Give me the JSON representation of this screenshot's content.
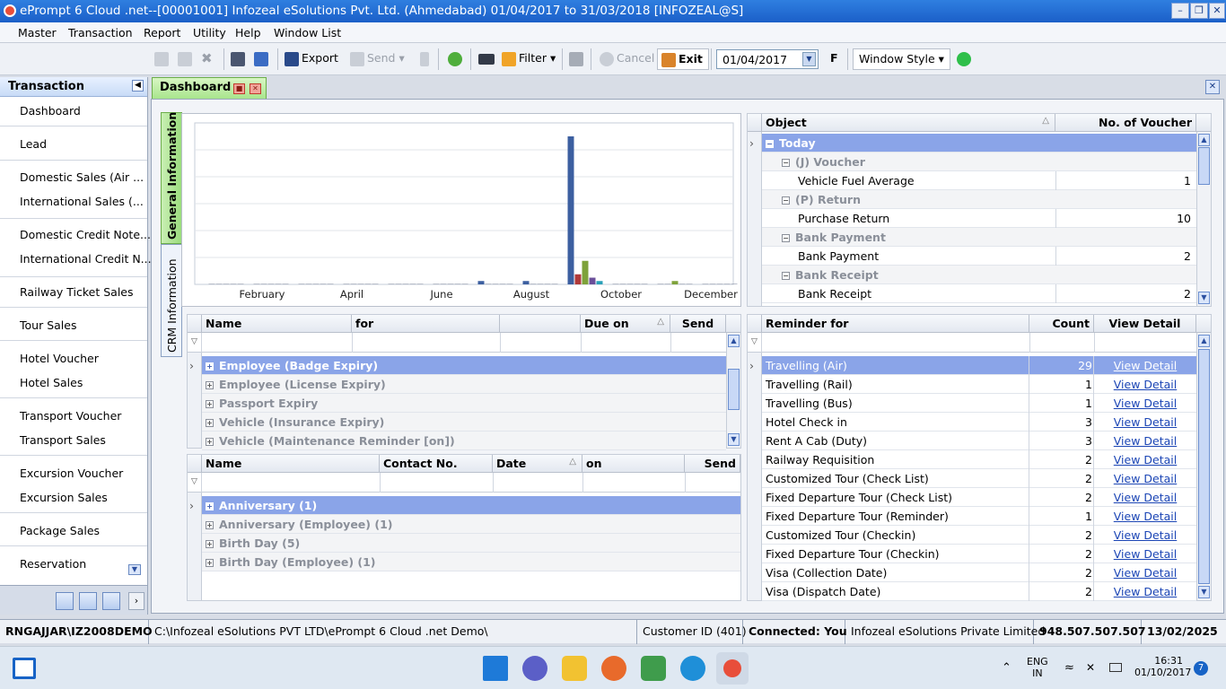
{
  "window": {
    "title": "ePrompt 6 Cloud .net--[00001001] Infozeal eSolutions Pvt. Ltd. (Ahmedabad) 01/04/2017 to 31/03/2018 [INFOZEAL@S]"
  },
  "menu": [
    "Master",
    "Transaction",
    "Report",
    "Utility",
    "Help",
    "Window List"
  ],
  "toolbar": {
    "export": "Export",
    "send": "Send",
    "filter": "Filter",
    "cancel": "Cancel",
    "exit": "Exit",
    "date": "01/04/2017",
    "f_label": "F",
    "window_style": "Window Style"
  },
  "sidebar": {
    "title": "Transaction",
    "items": [
      "Dashboard",
      "Lead",
      "Domestic Sales (Air ...",
      "International Sales (...",
      "Domestic Credit Note...",
      "International Credit N...",
      "Railway Ticket Sales",
      "Tour Sales",
      "Hotel Voucher",
      "Hotel Sales",
      "Transport Voucher",
      "Transport Sales",
      "Excursion Voucher",
      "Excursion Sales",
      "Package Sales",
      "Reservation"
    ]
  },
  "tabs": {
    "dashboard": "Dashboard",
    "vertical": [
      "General Information",
      "CRM Information"
    ]
  },
  "chart_data": {
    "type": "bar",
    "tick_labels": [
      "February",
      "April",
      "June",
      "August",
      "October",
      "December"
    ],
    "series": [
      {
        "color": "#3c5fa0",
        "values": [
          0,
          0,
          0,
          0,
          0,
          0,
          1,
          1,
          44,
          0,
          0,
          0
        ]
      },
      {
        "color": "#b03a3a",
        "values": [
          0,
          0,
          0,
          0,
          0,
          0,
          0,
          0,
          3,
          0,
          0,
          0
        ]
      },
      {
        "color": "#7ea23a",
        "values": [
          0,
          0,
          0,
          0,
          0,
          0,
          0,
          0,
          7,
          0,
          1,
          0
        ]
      },
      {
        "color": "#6b4f9a",
        "values": [
          0,
          0,
          0,
          0,
          0,
          0,
          0,
          0,
          2,
          0,
          0,
          0
        ]
      },
      {
        "color": "#2aa0b8",
        "values": [
          0,
          0,
          0,
          0,
          0,
          0,
          0,
          0,
          1,
          0,
          0,
          0
        ]
      }
    ],
    "ylim": [
      0,
      48
    ],
    "grid": true
  },
  "object_grid": {
    "headers": [
      "Object",
      "No. of Voucher"
    ],
    "rows": [
      {
        "kind": "sel",
        "label": "Today",
        "value": ""
      },
      {
        "kind": "grp",
        "label": "(J) Voucher",
        "value": ""
      },
      {
        "kind": "data",
        "label": "Vehicle Fuel Average",
        "value": "1"
      },
      {
        "kind": "grp",
        "label": "(P) Return",
        "value": ""
      },
      {
        "kind": "data",
        "label": "Purchase Return",
        "value": "10"
      },
      {
        "kind": "grp",
        "label": "Bank Payment",
        "value": ""
      },
      {
        "kind": "data",
        "label": "Bank Payment",
        "value": "2"
      },
      {
        "kind": "grp",
        "label": "Bank Receipt",
        "value": ""
      },
      {
        "kind": "data",
        "label": "Bank Receipt",
        "value": "2"
      }
    ]
  },
  "expiry_grid": {
    "headers": [
      "Name",
      "for",
      "",
      "Due on",
      "Send"
    ],
    "rows": [
      {
        "kind": "sel",
        "label": "Employee (Badge Expiry)"
      },
      {
        "kind": "grp",
        "label": "Employee (License Expiry)"
      },
      {
        "kind": "grp",
        "label": "Passport Expiry"
      },
      {
        "kind": "grp",
        "label": "Vehicle (Insurance Expiry)"
      },
      {
        "kind": "grp",
        "label": "Vehicle (Maintenance Reminder [on])"
      }
    ]
  },
  "event_grid": {
    "headers": [
      "Name",
      "Contact No.",
      "Date",
      "on",
      "Send"
    ],
    "rows": [
      {
        "kind": "sel",
        "label": "Anniversary (1)"
      },
      {
        "kind": "grp",
        "label": "Anniversary (Employee) (1)"
      },
      {
        "kind": "grp",
        "label": "Birth Day (5)"
      },
      {
        "kind": "grp",
        "label": "Birth Day (Employee) (1)"
      }
    ]
  },
  "reminder_grid": {
    "headers": [
      "Reminder for",
      "Count",
      "View Detail"
    ],
    "link_text": "View Detail",
    "rows": [
      {
        "label": "Travelling (Air)",
        "count": "29"
      },
      {
        "label": "Travelling (Rail)",
        "count": "1"
      },
      {
        "label": "Travelling (Bus)",
        "count": "1"
      },
      {
        "label": "Hotel Check in",
        "count": "3"
      },
      {
        "label": "Rent A Cab (Duty)",
        "count": "3"
      },
      {
        "label": "Railway Requisition",
        "count": "2"
      },
      {
        "label": "Customized Tour (Check List)",
        "count": "2"
      },
      {
        "label": "Fixed Departure Tour (Check List)",
        "count": "2"
      },
      {
        "label": "Fixed Departure Tour (Reminder)",
        "count": "1"
      },
      {
        "label": "Customized Tour (Checkin)",
        "count": "2"
      },
      {
        "label": "Fixed Departure Tour (Checkin)",
        "count": "2"
      },
      {
        "label": "Visa (Collection Date)",
        "count": "2"
      },
      {
        "label": "Visa (Dispatch Date)",
        "count": "2"
      }
    ]
  },
  "statusbar": {
    "user": "RNGAJJAR\\IZ2008DEMO",
    "path": "C:\\Infozeal eSolutions PVT LTD\\ePrompt 6 Cloud .net Demo\\",
    "customer": "Customer ID (401)",
    "connected": "Connected: You",
    "company": "Infozeal eSolutions Private Limited",
    "phone": "948.507.507.507",
    "date": "13/02/2025"
  },
  "taskbar": {
    "lang": "ENG",
    "region": "IN",
    "time": "16:31",
    "date": "01/10/2017",
    "badge": "7"
  }
}
